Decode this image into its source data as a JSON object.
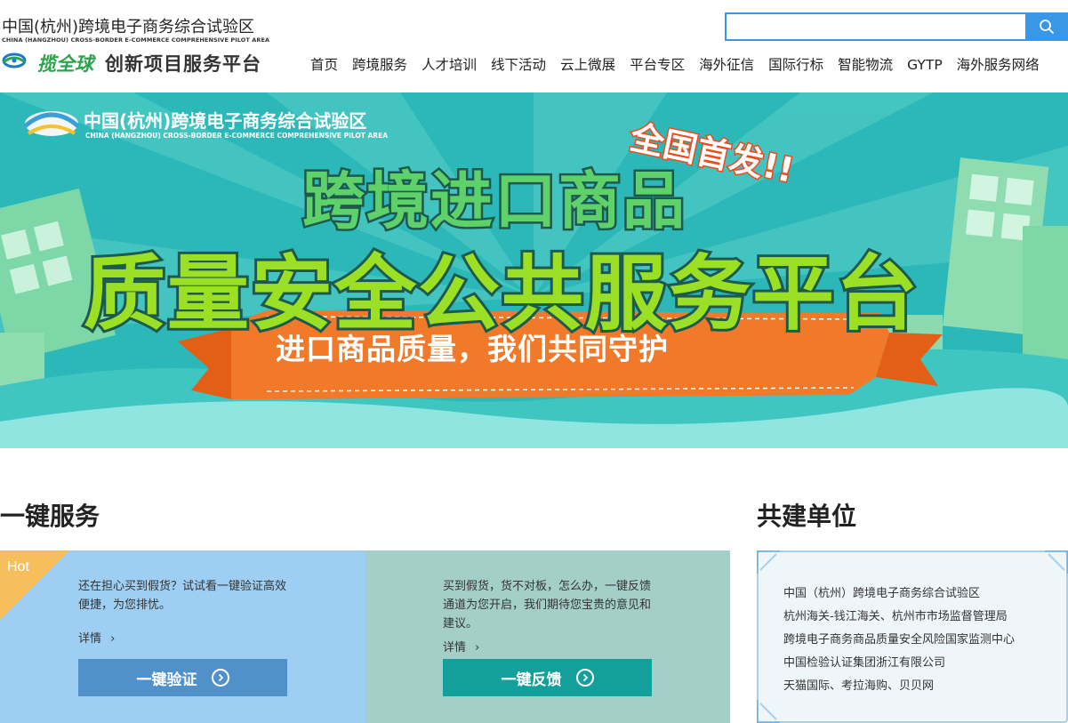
{
  "header": {
    "logo_cn": "中国(杭州)跨境电子商务综合试验区",
    "logo_en": "CHINA (HANGZHOU) CROSS-BORDER E-COMMERCE COMPREHENSIVE PILOT AREA",
    "brand": "揽全球",
    "brand_sub": "创新项目服务平台",
    "search": {
      "value": "",
      "placeholder": ""
    },
    "nav": [
      "首页",
      "跨境服务",
      "人才培训",
      "线下活动",
      "云上微展",
      "平台专区",
      "海外征信",
      "国际行标",
      "智能物流",
      "GYTP",
      "海外服务网络"
    ]
  },
  "banner": {
    "logo_cn": "中国(杭州)跨境电子商务综合试验区",
    "logo_en": "CHINA (HANGZHOU) CROSS-BORDER E-COMMERCE COMPREHENSIVE PILOT AREA",
    "tag": "全国首发!!",
    "title_line1": "跨境进口商品",
    "title_line2": "质量安全公共服务平台",
    "ribbon": "进口商品质量，我们共同守护"
  },
  "services": {
    "title": "一键服务",
    "cards": [
      {
        "badge": "Hot",
        "text": "还在担心买到假货？试试看一键验证高效便捷，为您排忧。",
        "more": "详情",
        "button": "一键验证",
        "color": "#4f91c8"
      },
      {
        "text": "买到假货，货不对板，怎么办，一键反馈通道为您开启，我们期待您宝贵的意见和建议。",
        "more": "详情",
        "button": "一键反馈",
        "color": "#14a09a"
      }
    ]
  },
  "partners": {
    "title": "共建单位",
    "items": [
      "中国（杭州）跨境电子商务综合试验区",
      "杭州海关-钱江海关、杭州市市场监督管理局",
      "跨境电子商务商品质量安全风险国家监测中心",
      "中国检验认证集团浙江有限公司",
      "天猫国际、考拉海购、贝贝网"
    ]
  },
  "colors": {
    "accent": "#3a97e8",
    "card1_bg": "#9ecff2",
    "card2_bg": "#a4cfc8",
    "hot_badge": "#f7bf5b"
  }
}
